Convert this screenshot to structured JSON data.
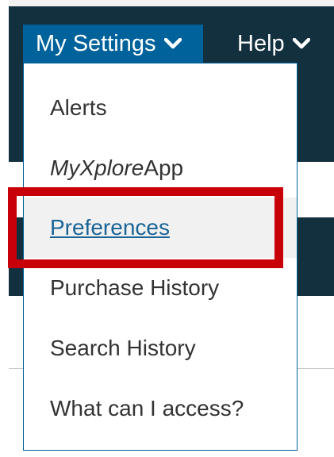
{
  "nav": {
    "settings_label": "My Settings",
    "help_label": "Help"
  },
  "menu": {
    "items": [
      {
        "label": "Alerts"
      },
      {
        "label_italic": "MyXplore",
        "label_rest": "App"
      },
      {
        "label": "Preferences"
      },
      {
        "label": "Purchase History"
      },
      {
        "label": "Search History"
      },
      {
        "label": "What can I access?"
      }
    ]
  },
  "colors": {
    "nav_background": "#13303f",
    "settings_background": "#00629b",
    "menu_border": "#00629b",
    "link_color": "#1a6496",
    "highlight": "#c8000a"
  },
  "icons": {
    "dropdown": "chevron-down-icon"
  }
}
